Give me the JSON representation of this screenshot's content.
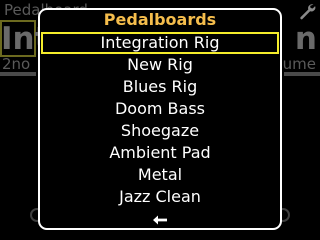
{
  "background": {
    "title": "Pedalboard",
    "current_name_left": "Int",
    "current_name_right": "n",
    "sub_left": "2no",
    "sub_right": "ume",
    "wrench_icon": "wrench-icon"
  },
  "popup": {
    "title": "Pedalboards",
    "selected_index": 0,
    "items": [
      {
        "label": "Integration Rig"
      },
      {
        "label": "New Rig"
      },
      {
        "label": "Blues Rig"
      },
      {
        "label": "Doom Bass"
      },
      {
        "label": "Shoegaze"
      },
      {
        "label": "Ambient Pad"
      },
      {
        "label": "Metal"
      },
      {
        "label": "Jazz Clean"
      }
    ],
    "back_icon": "back-arrow-icon"
  },
  "colors": {
    "title": "#f5bd4c",
    "selection": "#f4ec2b",
    "text": "#ffffff",
    "border": "#ffffff",
    "background": "#000000"
  }
}
